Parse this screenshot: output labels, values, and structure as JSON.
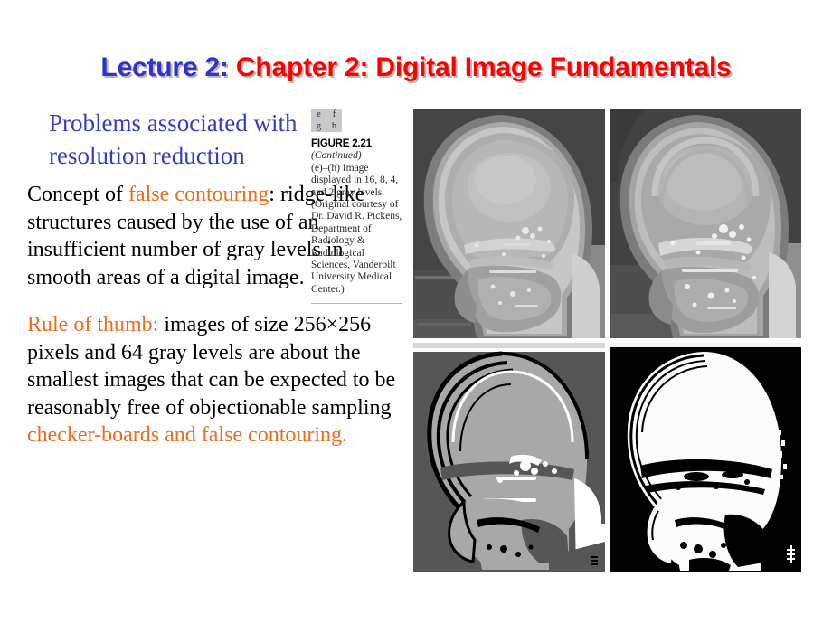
{
  "slide": {
    "title": {
      "lecture_part": "Lecture 2:",
      "chapter_part": " Chapter 2: Digital Image Fundamentals",
      "lecture_color": "#3333CC",
      "chapter_color": "#FF0000",
      "shadow_color": "#B9B9B9"
    },
    "heading": "Problems associated with resolution reduction",
    "heading_color": "#3A3AC8",
    "highlight_color": "#EF6C1E",
    "body_color": "#000000",
    "paragraph_contouring": {
      "lead": "Concept of ",
      "highlight": "false contouring",
      "rest": ": ridge-like structures caused by the use of an insufficient number of gray levels in smooth areas of a digital image."
    },
    "paragraph_rule": {
      "highlight_lead": "Rule of thumb:",
      "middle": " images of size 256×256 pixels and 64 gray levels are about the smallest images that can be expected to be reasonably free of objectionable sampling ",
      "highlight_tail": "checker-boards and false contouring."
    }
  },
  "figure": {
    "panel_key": [
      "e",
      "f",
      "g",
      "h"
    ],
    "number": "FIGURE 2.21",
    "continued": "(Continued)",
    "body": "(e)–(h) Image displayed in 16, 8, 4, and 2 gray levels. (Original courtesy of Dr. David R. Pickens, Department of Radiology & Radiological Sciences, Vanderbilt University Medical Center.)"
  },
  "images": {
    "panels": [
      {
        "key": "e",
        "name": "skull-xray-16-levels",
        "gray_levels": 16,
        "alt": "Skull X-ray displayed in 16 gray levels"
      },
      {
        "key": "f",
        "name": "skull-xray-8-levels",
        "gray_levels": 8,
        "alt": "Skull X-ray displayed in 8 gray levels"
      },
      {
        "key": "g",
        "name": "skull-xray-4-levels",
        "gray_levels": 4,
        "alt": "Skull X-ray displayed in 4 gray levels"
      },
      {
        "key": "h",
        "name": "skull-xray-2-levels",
        "gray_levels": 2,
        "alt": "Skull X-ray displayed in 2 gray levels"
      }
    ]
  }
}
